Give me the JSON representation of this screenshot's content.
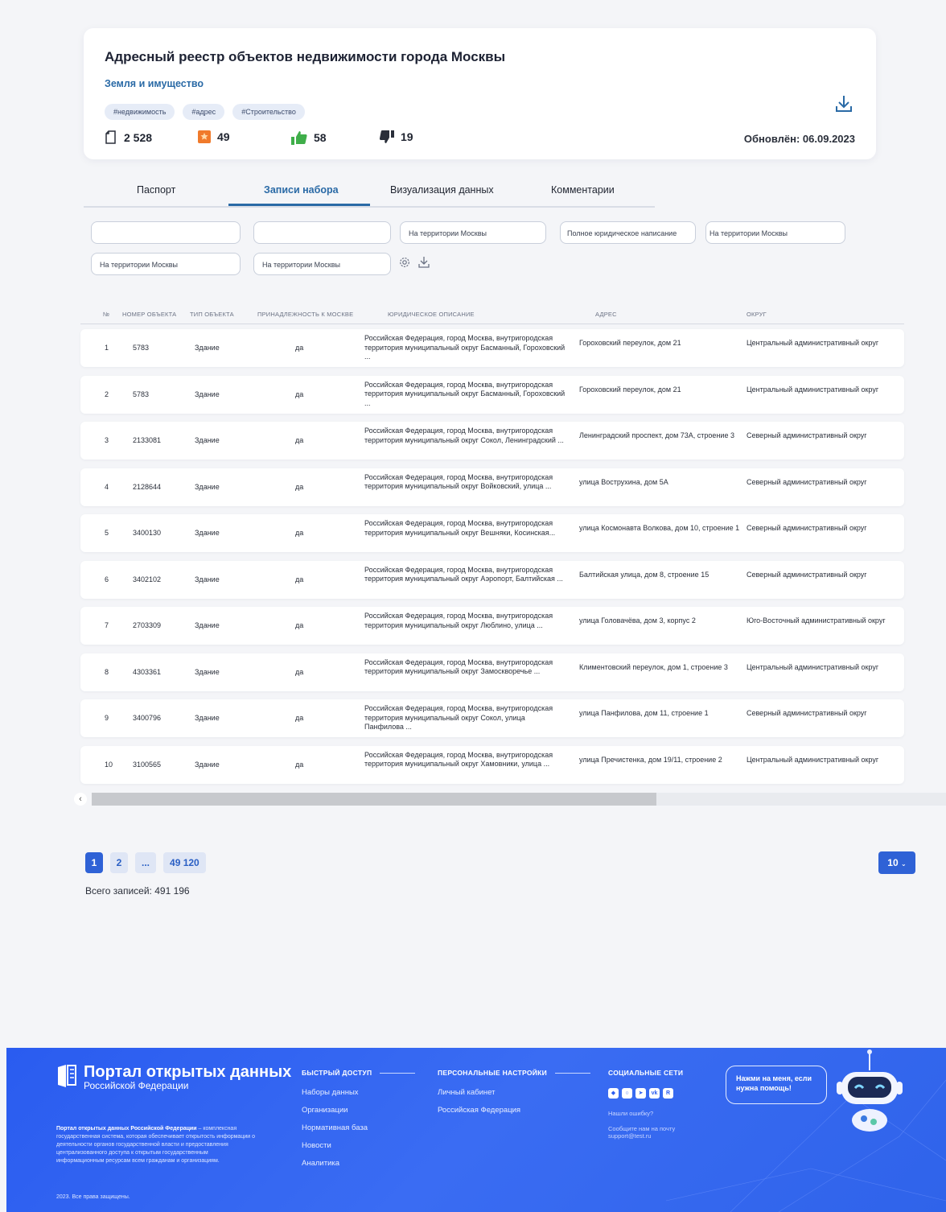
{
  "dataset": {
    "title": "Адресный реестр объектов недвижимости города Москвы",
    "category": "Земля и имущество",
    "tags": [
      "#недвижимость",
      "#адрес",
      "#Строительство"
    ],
    "stats": {
      "docs": "2 528",
      "bookmarks": "49",
      "likes": "58",
      "dislikes": "19"
    },
    "updated": "Обновлён: 06.09.2023"
  },
  "tabs": [
    "Паспорт",
    "Записи набора",
    "Визуализация данных",
    "Комментарии"
  ],
  "filters": {
    "row1": [
      "",
      "",
      "На территории Москвы",
      "Полное юридическое написание",
      "На территории Москвы"
    ],
    "row2": [
      "На территории Москвы",
      "На территории Москвы"
    ]
  },
  "table": {
    "headers": [
      "№",
      "НОМЕР ОБЪЕКТА",
      "ТИП ОБЪЕКТА",
      "ПРИНАДЛЕЖНОСТЬ К МОСКВЕ",
      "ЮРИДИЧЕСКОЕ ОПИСАНИЕ",
      "АДРЕС",
      "ОКРУГ"
    ],
    "rows": [
      {
        "num": "1",
        "id": "5783",
        "type": "Здание",
        "belong": "да",
        "desc": "Российская Федерация, город Москва, внутригородская территория муниципальный округ Басманный, Гороховский ...",
        "addr": "Гороховский переулок, дом 21",
        "okrug": "Центральный административный округ"
      },
      {
        "num": "2",
        "id": "5783",
        "type": "Здание",
        "belong": "да",
        "desc": "Российская Федерация, город Москва, внутригородская территория муниципальный округ Басманный, Гороховский ...",
        "addr": "Гороховский переулок, дом 21",
        "okrug": "Центральный административный округ"
      },
      {
        "num": "3",
        "id": "2133081",
        "type": "Здание",
        "belong": "да",
        "desc": "Российская Федерация, город Москва, внутригородская территория муниципальный округ Сокол, Ленинградский ...",
        "addr": "Ленинградский проспект, дом 73А, строение 3",
        "okrug": "Северный административный округ"
      },
      {
        "num": "4",
        "id": "2128644",
        "type": "Здание",
        "belong": "да",
        "desc": "Российская Федерация, город Москва, внутригородская территория муниципальный округ Войковский, улица ...",
        "addr": "улица Вострухина, дом 5А",
        "okrug": "Северный административный округ"
      },
      {
        "num": "5",
        "id": "3400130",
        "type": "Здание",
        "belong": "да",
        "desc": "Российская Федерация, город Москва, внутригородская территория муниципальный округ Вешняки, Косинская...",
        "addr": "улица Космонавта Волкова, дом 10, строение 1",
        "okrug": "Северный административный округ"
      },
      {
        "num": "6",
        "id": "3402102",
        "type": "Здание",
        "belong": "да",
        "desc": "Российская Федерация, город Москва, внутригородская территория муниципальный округ Аэропорт, Балтийская ...",
        "addr": "Балтийская улица, дом 8, строение 15",
        "okrug": "Северный административный округ"
      },
      {
        "num": "7",
        "id": "2703309",
        "type": "Здание",
        "belong": "да",
        "desc": "Российская Федерация, город Москва, внутригородская территория муниципальный округ Люблино, улица ...",
        "addr": "улица Головачёва, дом 3, корпус 2",
        "okrug": "Юго-Восточный административный округ"
      },
      {
        "num": "8",
        "id": "4303361",
        "type": "Здание",
        "belong": "да",
        "desc": "Российская Федерация, город Москва, внутригородская территория муниципальный округ Замоскворечье ...",
        "addr": "Климентовский переулок, дом 1, строение 3",
        "okrug": "Центральный административный округ"
      },
      {
        "num": "9",
        "id": "3400796",
        "type": "Здание",
        "belong": "да",
        "desc": "Российская Федерация, город Москва, внутригородская территория муниципальный округ Сокол, улица Панфилова ...",
        "addr": "улица Панфилова, дом 11, строение 1",
        "okrug": "Северный административный округ"
      },
      {
        "num": "10",
        "id": "3100565",
        "type": "Здание",
        "belong": "да",
        "desc": "Российская Федерация, город Москва, внутригородская территория муниципальный округ Хамовники, улица ...",
        "addr": "улица Пречистенка, дом 19/11, строение 2",
        "okrug": "Центральный административный округ"
      }
    ]
  },
  "scroll": {
    "position_fraction": 0.0
  },
  "pagination": {
    "pages": [
      "1",
      "2",
      "...",
      "49 120"
    ],
    "current": "1",
    "total": "Всего записей: 491 196",
    "per_page": "10"
  },
  "footer": {
    "logo_title": "Портал открытых данных",
    "logo_sub": "Российской Федерации",
    "about_bold": "Портал открытых данных Российской Федерации",
    "about_rest": " – комплексная государственная система, которая обеспечивает открытость информации о деятельности органов государственной власти и предоставления централизованного доступа к открытым государственным информационным ресурсам всем гражданам и организациям.",
    "quick_title": "БЫСТРЫЙ ДОСТУП",
    "quick_links": [
      "Наборы данных",
      "Организации",
      "Нормативная база",
      "Новости",
      "Аналитика"
    ],
    "personal_title": "ПЕРСОНАЛЬНЫЕ НАСТРОЙКИ",
    "personal_links": [
      "Личный кабинет",
      "Российская Федерация"
    ],
    "social_title": "СОЦИАЛЬНЫЕ СЕТИ",
    "error_text": "Нашли ошибку?",
    "mail_text": "Сообщите нам на почту",
    "mail": "support@test.ru",
    "bubble": "Нажми на меня, если нужна помощь!",
    "copyright": "2023. Все права защищены."
  },
  "colors": {
    "accent": "#2a6aa6",
    "button": "#2f62d6",
    "footer": "#2f63ea"
  }
}
